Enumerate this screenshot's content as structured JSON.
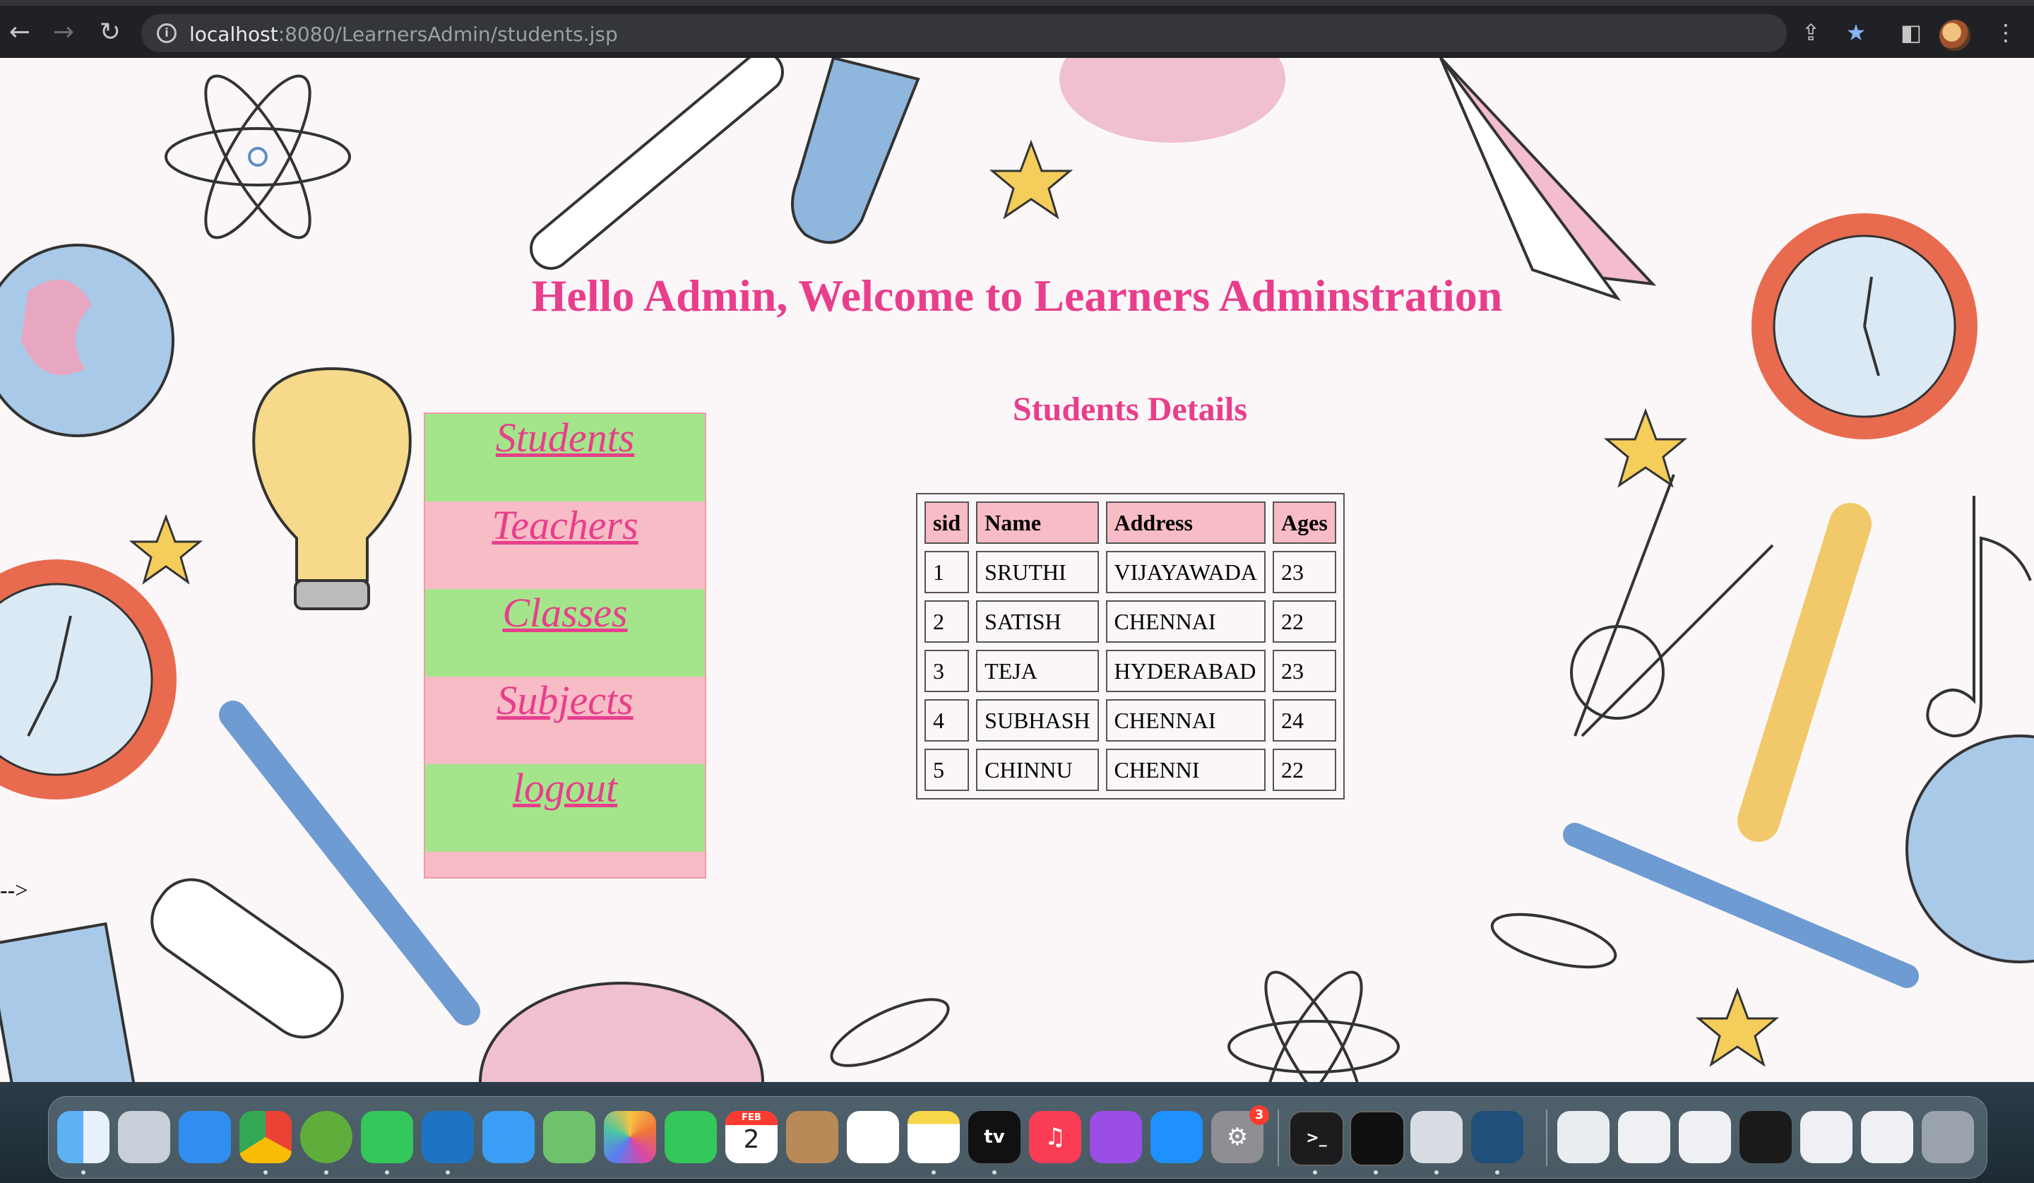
{
  "browser": {
    "url_host": "localhost",
    "url_path": ":8080/LearnersAdmin/students.jsp"
  },
  "page": {
    "heading": "Hello Admin, Welcome to Learners Adminstration",
    "comment_text": "-->",
    "menu": [
      "Students",
      "Teachers",
      "Classes",
      "Subjects",
      "logout"
    ],
    "table_title": "Students Details",
    "table": {
      "headers": [
        "sid",
        "Name",
        "Address",
        "Ages"
      ],
      "rows": [
        [
          "1",
          "SRUTHI",
          "VIJAYAWADA",
          "23"
        ],
        [
          "2",
          "SATISH",
          "CHENNAI",
          "22"
        ],
        [
          "3",
          "TEJA",
          "HYDERABAD",
          "23"
        ],
        [
          "4",
          "SUBHASH",
          "CHENNAI",
          "24"
        ],
        [
          "5",
          "CHINNU",
          "CHENNI",
          "22"
        ]
      ]
    }
  },
  "dock": {
    "calendar_month": "FEB",
    "calendar_day": "2",
    "settings_badge": "3",
    "tv_label": "tv"
  },
  "colors": {
    "accent": "#e83e8c",
    "menu_green": "#a4e58c",
    "menu_pink": "#f7bcc5"
  }
}
